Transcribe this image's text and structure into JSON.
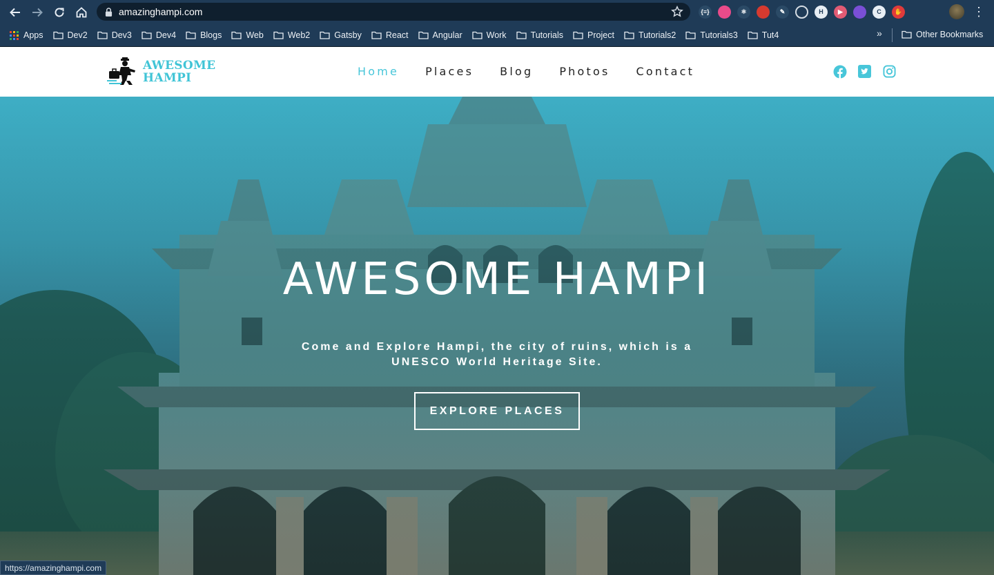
{
  "browser": {
    "url": "amazinghampi.com",
    "bookmarks": [
      {
        "label": "Apps",
        "icon": "apps-grid-icon"
      },
      {
        "label": "Dev2",
        "icon": "folder-icon"
      },
      {
        "label": "Dev3",
        "icon": "folder-icon"
      },
      {
        "label": "Dev4",
        "icon": "folder-icon"
      },
      {
        "label": "Blogs",
        "icon": "folder-icon"
      },
      {
        "label": "Web",
        "icon": "folder-icon"
      },
      {
        "label": "Web2",
        "icon": "folder-icon"
      },
      {
        "label": "Gatsby",
        "icon": "folder-icon"
      },
      {
        "label": "React",
        "icon": "folder-icon"
      },
      {
        "label": "Angular",
        "icon": "folder-icon"
      },
      {
        "label": "Work",
        "icon": "folder-icon"
      },
      {
        "label": "Tutorials",
        "icon": "folder-icon"
      },
      {
        "label": "Project",
        "icon": "folder-icon"
      },
      {
        "label": "Tutorials2",
        "icon": "folder-icon"
      },
      {
        "label": "Tutorials3",
        "icon": "folder-icon"
      },
      {
        "label": "Tut4",
        "icon": "folder-icon"
      }
    ],
    "more_bookmarks": "»",
    "other_bookmarks": "Other Bookmarks",
    "status_url": "https://amazinghampi.com",
    "extensions": [
      {
        "name": "json-viewer-icon",
        "color": "#2b4a66",
        "glyph": "{≡}"
      },
      {
        "name": "color-picker-icon",
        "color": "#e94b8a",
        "glyph": ""
      },
      {
        "name": "react-devtools-icon",
        "color": "#2b4a66",
        "glyph": "⚛"
      },
      {
        "name": "santa-icon",
        "color": "#d63a2f",
        "glyph": ""
      },
      {
        "name": "pen-extension-icon",
        "color": "#2b4a66",
        "glyph": "✎"
      },
      {
        "name": "target-icon",
        "color": "ring",
        "glyph": ""
      },
      {
        "name": "h-extension-icon",
        "color": "#e8eef4",
        "glyph": "H"
      },
      {
        "name": "video-extension-icon",
        "color": "#e25b74",
        "glyph": "▶"
      },
      {
        "name": "swirl-extension-icon",
        "color": "#7a4fd6",
        "glyph": ""
      },
      {
        "name": "c-extension-icon",
        "color": "#e8eef4",
        "glyph": "C"
      },
      {
        "name": "hand-extension-icon",
        "color": "#e03b3b",
        "glyph": "✋"
      }
    ]
  },
  "site": {
    "logo_line1": "AWESOME",
    "logo_line2": "HAMPI",
    "nav": [
      {
        "label": "Home",
        "active": true
      },
      {
        "label": "Places",
        "active": false
      },
      {
        "label": "Blog",
        "active": false
      },
      {
        "label": "Photos",
        "active": false
      },
      {
        "label": "Contact",
        "active": false
      }
    ],
    "social": [
      "facebook-icon",
      "twitter-icon",
      "instagram-icon"
    ],
    "accent_color": "#48c6d9"
  },
  "hero": {
    "title": "AWESOME HAMPI",
    "subtitle": "Come and Explore Hampi, the city of ruins, which is a UNESCO World Heritage Site.",
    "cta_label": "EXPLORE PLACES"
  }
}
